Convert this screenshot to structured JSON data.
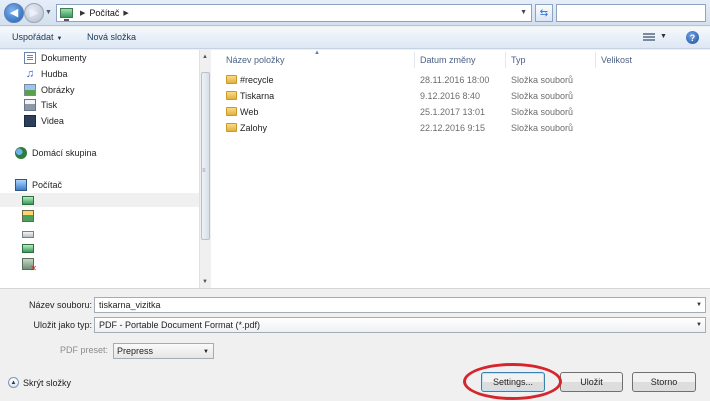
{
  "address": {
    "crumb": "Počítač",
    "icons": [
      "back-icon",
      "forward-icon",
      "computer-icon",
      "refresh-icon"
    ]
  },
  "toolbar": {
    "organize_label": "Uspořádat",
    "newfolder_label": "Nová složka"
  },
  "nav": {
    "items": [
      {
        "label": "Dokumenty",
        "icon": "documents-icon"
      },
      {
        "label": "Hudba",
        "icon": "music-icon"
      },
      {
        "label": "Obrázky",
        "icon": "pictures-icon"
      },
      {
        "label": "Tisk",
        "icon": "print-icon"
      },
      {
        "label": "Videa",
        "icon": "video-icon"
      }
    ],
    "homegroup": "Domácí skupina",
    "computer": "Počítač"
  },
  "columns": {
    "name": "Název položky",
    "date": "Datum změny",
    "type": "Typ",
    "size": "Velikost"
  },
  "files": [
    {
      "name": "#recycle",
      "date": "28.11.2016 18:00",
      "type": "Složka souborů"
    },
    {
      "name": "Tiskarna",
      "date": "9.12.2016 8:40",
      "type": "Složka souborů"
    },
    {
      "name": "Web",
      "date": "25.1.2017 13:01",
      "type": "Složka souborů"
    },
    {
      "name": "Zalohy",
      "date": "22.12.2016 9:15",
      "type": "Složka souborů"
    }
  ],
  "form": {
    "filename_label": "Název souboru:",
    "filename_value": "tiskarna_vizitka",
    "filetype_label": "Uložit jako typ:",
    "filetype_value": "PDF - Portable Document Format (*.pdf)",
    "preset_label": "PDF preset:",
    "preset_value": "Prepress"
  },
  "footer": {
    "hide_folders": "Skrýt složky",
    "settings": "Settings...",
    "save": "Uložit",
    "cancel": "Storno"
  },
  "colors": {
    "highlight_ring": "#d4262c",
    "accent": "#3c7fb1"
  }
}
